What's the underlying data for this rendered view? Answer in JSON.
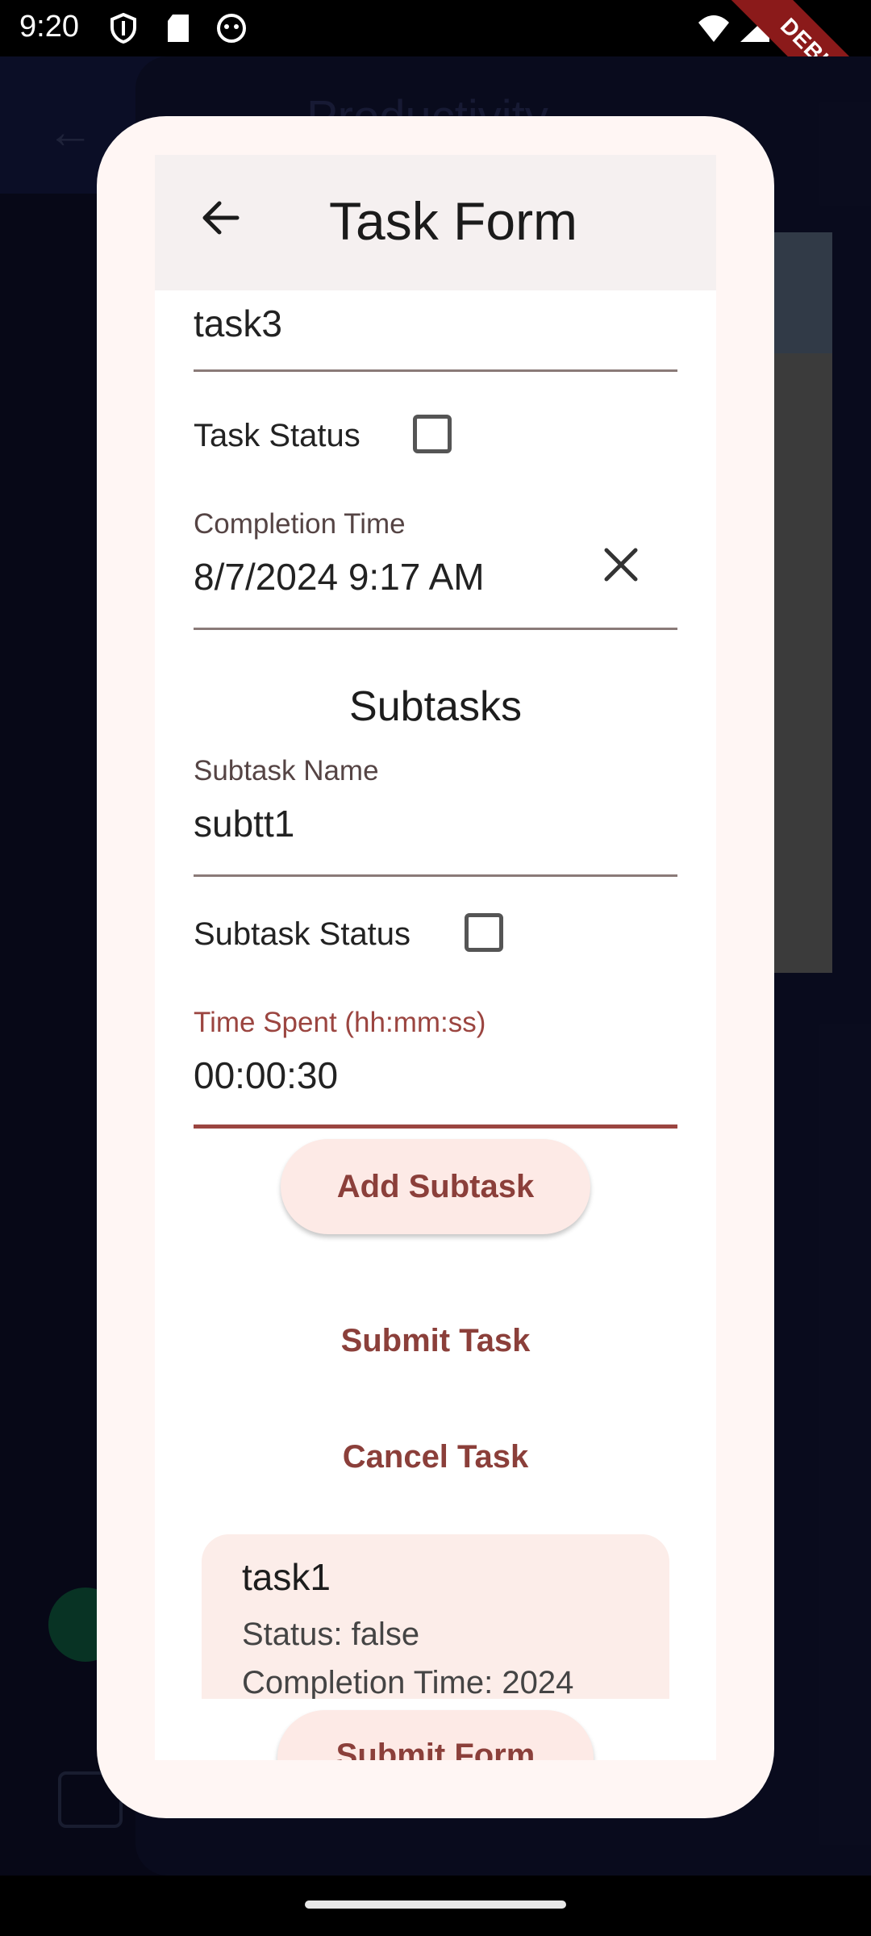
{
  "status_bar": {
    "time": "9:20",
    "debug_banner": "DEBUG"
  },
  "background_app": {
    "title": "Productivity"
  },
  "dialog": {
    "title": "Task Form",
    "task_name_value": "task3",
    "task_status_label": "Task Status",
    "task_status_checked": false,
    "completion_time_label": "Completion Time",
    "completion_time_value": "8/7/2024 9:17 AM",
    "subtasks_heading": "Subtasks",
    "subtask_name_label": "Subtask Name",
    "subtask_name_value": "subtt1",
    "subtask_status_label": "Subtask Status",
    "subtask_status_checked": false,
    "time_spent_label": "Time Spent (hh:mm:ss)",
    "time_spent_value": "00:00:30",
    "add_subtask_label": "Add Subtask",
    "submit_task_label": "Submit Task",
    "cancel_task_label": "Cancel Task",
    "task_card": {
      "title": "task1",
      "status": "Status: false",
      "completion": "Completion Time: 2024"
    },
    "submit_form_label": "Submit Form"
  },
  "colors": {
    "accent": "#8b3f3a",
    "dialog_bg": "#fff6f4",
    "button_bg": "#fdeae6",
    "background": "#0d0f2a"
  }
}
